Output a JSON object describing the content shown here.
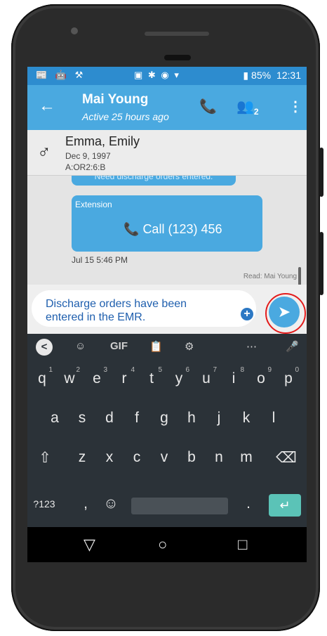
{
  "status": {
    "left_icons": "📰 🤖 ⚒",
    "mid_icons": "▣ ✱ ◉ ▾",
    "battery": "85%",
    "time": "12:31"
  },
  "appbar": {
    "back": "←",
    "title": "Mai Young",
    "subtitle": "Active 25 hours ago",
    "phone": "📞",
    "group": "👥",
    "group_count": "2",
    "more": "⋮"
  },
  "patient": {
    "gender_symbol": "♂",
    "name": "Emma, Emily",
    "dob": "Dec 9, 1997",
    "id": "A:OR2:6:B"
  },
  "messages": {
    "previous_snippet": "Need discharge orders entered.",
    "ext_label": "Extension",
    "call_label": "Call (123) 456",
    "time": "Jul 15 5:46 PM",
    "read_by": "Read: Mai Young"
  },
  "composer": {
    "text": "Discharge orders have been entered in the EMR.",
    "plus": "+",
    "send": "➤"
  },
  "keyboard": {
    "tools": [
      "<",
      "☺",
      "GIF",
      "📋",
      "⚙",
      "⋯",
      "🎤"
    ],
    "row1": [
      {
        "k": "q",
        "n": "1"
      },
      {
        "k": "w",
        "n": "2"
      },
      {
        "k": "e",
        "n": "3"
      },
      {
        "k": "r",
        "n": "4"
      },
      {
        "k": "t",
        "n": "5"
      },
      {
        "k": "y",
        "n": "6"
      },
      {
        "k": "u",
        "n": "7"
      },
      {
        "k": "i",
        "n": "8"
      },
      {
        "k": "o",
        "n": "9"
      },
      {
        "k": "p",
        "n": "0"
      }
    ],
    "row2": [
      "a",
      "s",
      "d",
      "f",
      "g",
      "h",
      "j",
      "k",
      "l"
    ],
    "row3": [
      "⇧",
      "z",
      "x",
      "c",
      "v",
      "b",
      "n",
      "m",
      "⌫"
    ],
    "row4": [
      "?123",
      ",",
      "☺",
      "",
      ".",
      "↵"
    ]
  },
  "nav": {
    "back": "▽",
    "home": "○",
    "recents": "□"
  },
  "colors": {
    "accent": "#4aa9e0",
    "status_bar": "#2d8ccf",
    "highlight_ring": "#e31b1b",
    "keyboard_bg": "#2b3238",
    "enter_key": "#5bc3b7"
  }
}
